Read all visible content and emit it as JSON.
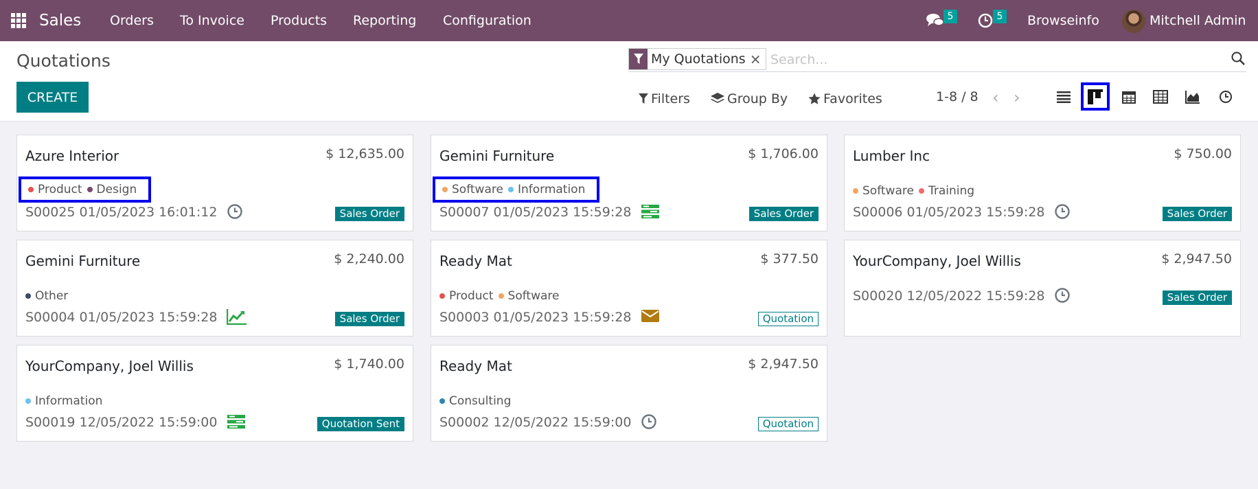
{
  "nav": {
    "app_name": "Sales",
    "menu": [
      "Orders",
      "To Invoice",
      "Products",
      "Reporting",
      "Configuration"
    ],
    "messages_count": "5",
    "activities_count": "5",
    "company": "Browseinfo",
    "user": "Mitchell Admin"
  },
  "control": {
    "title": "Quotations",
    "create_label": "CREATE",
    "facet_label": "My Quotations",
    "facet_remove": "×",
    "search_placeholder": "Search...",
    "filters_label": "Filters",
    "groupby_label": "Group By",
    "favorites_label": "Favorites",
    "pager": "1-8 / 8",
    "views": [
      "list",
      "kanban",
      "calendar",
      "pivot",
      "graph",
      "activity"
    ],
    "active_view": "kanban"
  },
  "tag_colors": {
    "Product": "#e8514c",
    "Design": "#7a4a6a",
    "Software": "#f4a460",
    "Information": "#6cc1ed",
    "Training": "#ee6b6e",
    "Other": "#3c4b64",
    "Consulting": "#2e86ab"
  },
  "cards": [
    {
      "customer": "Azure Interior",
      "amount": "$ 12,635.00",
      "tags": [
        "Product",
        "Design"
      ],
      "ref": "S00025 01/05/2023 16:01:12",
      "activity": "clock-icon",
      "state": "Sales Order",
      "state_style": "filled",
      "highlight": true
    },
    {
      "customer": "Gemini Furniture",
      "amount": "$ 1,706.00",
      "tags": [
        "Software",
        "Information"
      ],
      "ref": "S00007 01/05/2023 15:59:28",
      "activity": "tasks-icon",
      "state": "Sales Order",
      "state_style": "filled",
      "highlight": true
    },
    {
      "customer": "Lumber Inc",
      "amount": "$ 750.00",
      "tags": [
        "Software",
        "Training"
      ],
      "ref": "S00006 01/05/2023 15:59:28",
      "activity": "clock-icon",
      "state": "Sales Order",
      "state_style": "filled",
      "highlight": false
    },
    {
      "customer": "Gemini Furniture",
      "amount": "$ 2,240.00",
      "tags": [
        "Other"
      ],
      "ref": "S00004 01/05/2023 15:59:28",
      "activity": "chart-line-icon",
      "state": "Sales Order",
      "state_style": "filled",
      "highlight": false
    },
    {
      "customer": "Ready Mat",
      "amount": "$ 377.50",
      "tags": [
        "Product",
        "Software"
      ],
      "ref": "S00003 01/05/2023 15:59:28",
      "activity": "envelope-icon",
      "state": "Quotation",
      "state_style": "outline",
      "highlight": false
    },
    {
      "customer": "YourCompany, Joel Willis",
      "amount": "$ 2,947.50",
      "tags": [],
      "ref": "S00020 12/05/2022 15:59:28",
      "activity": "clock-icon",
      "state": "Sales Order",
      "state_style": "filled",
      "highlight": false
    },
    {
      "customer": "YourCompany, Joel Willis",
      "amount": "$ 1,740.00",
      "tags": [
        "Information"
      ],
      "ref": "S00019 12/05/2022 15:59:00",
      "activity": "tasks-icon",
      "state": "Quotation Sent",
      "state_style": "filled",
      "highlight": false
    },
    {
      "customer": "Ready Mat",
      "amount": "$ 2,947.50",
      "tags": [
        "Consulting"
      ],
      "ref": "S00002 12/05/2022 15:59:00",
      "activity": "clock-icon",
      "state": "Quotation",
      "state_style": "outline",
      "highlight": false
    }
  ]
}
